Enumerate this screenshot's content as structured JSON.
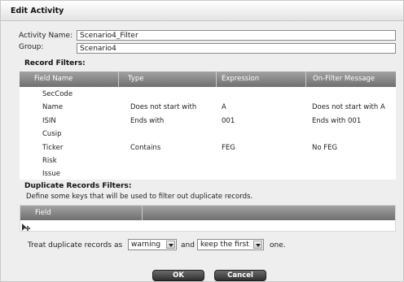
{
  "dialog": {
    "title": "Edit Activity",
    "activity_name_label": "Activity Name:",
    "activity_name_value": "Scenario4_Filter",
    "group_label": "Group:",
    "group_value": "Scenario4"
  },
  "record_filters": {
    "heading": "Record Filters:",
    "columns": [
      "Field Name",
      "Type",
      "Expression",
      "On-Filter Message"
    ],
    "rows": [
      [
        "SecCode",
        "",
        "",
        ""
      ],
      [
        "Name",
        "Does not start with",
        "A",
        "Does not start with A"
      ],
      [
        "ISIN",
        "Ends with",
        "001",
        "Ends with 001"
      ],
      [
        "Cusip",
        "",
        "",
        ""
      ],
      [
        "Ticker",
        "Contains",
        "FEG",
        "No FEG"
      ],
      [
        "Risk",
        "",
        "",
        ""
      ],
      [
        "Issue",
        "",
        "",
        ""
      ]
    ]
  },
  "duplicate_filters": {
    "heading": "Duplicate Records Filters:",
    "hint": "Define some keys that will be used to filter out duplicate records.",
    "columns": [
      "Field"
    ],
    "row_marker_icon": "new-row-arrow-icon"
  },
  "duplicate_treatment": {
    "prefix": "Treat duplicate records as",
    "mode_value": "warning",
    "middle": "and",
    "keep_value": "keep the first",
    "suffix": "one."
  },
  "buttons": {
    "ok": "OK",
    "cancel": "Cancel"
  }
}
